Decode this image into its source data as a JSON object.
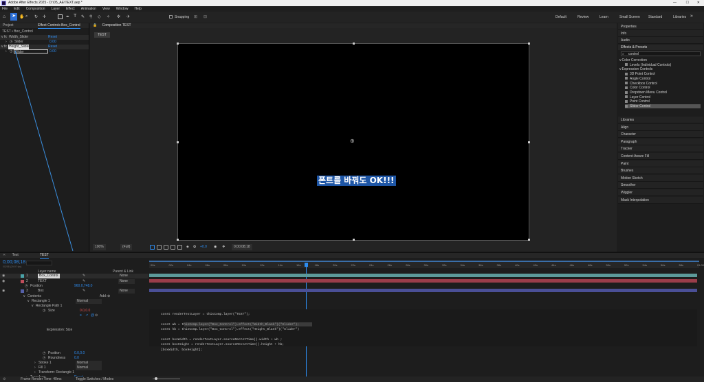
{
  "title_bar": {
    "title": "Adobe After Effects 2025 - D:\\05_AE\\TEXT.aep *"
  },
  "menu": [
    "File",
    "Edit",
    "Composition",
    "Layer",
    "Effect",
    "Animation",
    "View",
    "Window",
    "Help"
  ],
  "toolbar": {
    "snapping": "Snapping"
  },
  "workspaces": [
    "Default",
    "Review",
    "Learn",
    "Small Screen",
    "Standard",
    "Libraries"
  ],
  "project_panel": {
    "tab_project": "Project",
    "tab_effect_controls": "Effect Controls Box_Control",
    "subtitle": "TEST • Box_Control",
    "effects": [
      {
        "name": "Width_Slider",
        "reset": "Reset",
        "prop": "Slider",
        "value": "0.00"
      },
      {
        "name": "Height_Slider",
        "reset": "Reset",
        "prop": "Slider",
        "value": "0.00"
      }
    ]
  },
  "composition": {
    "tab": "Composition TEST",
    "comp_name": "TEST",
    "text": "폰트를 바꿔도 OK!!!",
    "footer": {
      "zoom": "100%",
      "res": "(Full)",
      "fps": "+0.0",
      "time": "0;00;08;18"
    }
  },
  "right_panel": {
    "items_top": [
      "Properties",
      "Info",
      "Audio"
    ],
    "effects_presets": "Effects & Presets",
    "search": "control",
    "tree": [
      {
        "label": "Color Correction",
        "level": 0
      },
      {
        "label": "Levels (Individual Controls)",
        "level": 1
      },
      {
        "label": "Expression Controls",
        "level": 0
      },
      {
        "label": "3D Point Control",
        "level": 1
      },
      {
        "label": "Angle Control",
        "level": 1
      },
      {
        "label": "Checkbox Control",
        "level": 1
      },
      {
        "label": "Color Control",
        "level": 1
      },
      {
        "label": "Dropdown Menu Control",
        "level": 1
      },
      {
        "label": "Layer Control",
        "level": 1
      },
      {
        "label": "Point Control",
        "level": 1
      },
      {
        "label": "Slider Control",
        "level": 1
      }
    ],
    "items_bottom": [
      "Libraries",
      "Align",
      "Character",
      "Paragraph",
      "Tracker",
      "Content-Aware Fill",
      "Paint",
      "Brushes",
      "Motion Sketch",
      "Smoother",
      "Wiggler",
      "Mask Interpolation"
    ]
  },
  "timeline": {
    "tab_text": "Text",
    "tab_test": "TEST",
    "timecode": "0;00;08;18",
    "frames": "00258 (29.97 fps)",
    "col_layer_name": "Layer name",
    "col_parent": "Parent & Link",
    "layers": [
      {
        "num": "1",
        "name": "Box_Control",
        "parent": "None",
        "color": "#4aa3a8"
      },
      {
        "num": "2",
        "name": "TEXT",
        "parent": "None",
        "color": "#c04d5b"
      },
      {
        "num": "3",
        "name": "Box",
        "parent": "None",
        "color": "#5560a8"
      }
    ],
    "position_label": "Position",
    "position_value": "960.0,748.0",
    "contents": "Contents",
    "add": "Add:",
    "rectangle": "Rectangle 1",
    "rect_path": "Rectangle Path 1",
    "size_label": "Size",
    "size_value": "0.0,0.0",
    "normal": "Normal",
    "expression_label": "Expression: Size",
    "pos2_label": "Position",
    "pos2_value": "0.0,0.0",
    "roundness_label": "Roundness",
    "roundness_value": "0.0",
    "stroke": "Stroke 1",
    "fill": "Fill 1",
    "transform": "Transform: Rectangle 1",
    "transform2": "Transform",
    "reset": "Reset",
    "ticks": [
      "00s",
      "02s",
      "04s",
      "06s",
      "08s",
      "10s",
      "12s",
      "14s",
      "16s",
      "18s",
      "20s",
      "22s",
      "24s",
      "26s",
      "28s",
      "30s",
      "32s",
      "34s",
      "36s",
      "38s",
      "40s",
      "42s",
      "44s",
      "46s",
      "48s",
      "50s",
      "52s",
      "54s",
      "56s",
      "58s",
      "01:00"
    ],
    "footer_render": "Frame Render Time: 40ms",
    "footer_toggle": "Toggle Switches / Modes"
  },
  "code_lines": [
    "const renderTextLayer = thisComp.layer(\"TEXT\");",
    "",
    "const wb = thisComp.layer(\"Box_Control\").effect(\"Width_Blank\")(\"Slider\");",
    "const hb = thisComp.layer(\"Box_Control\").effect(\"Height_Blank\")(\"Slider\")",
    "",
    "const boxWidth = renderTextLayer.sourceRectAtTime().width + wb ;",
    "const boxHeight = renderTextLayer.sourceRectAtTime().height + hb;",
    "[boxWidth, boxHeight];"
  ]
}
